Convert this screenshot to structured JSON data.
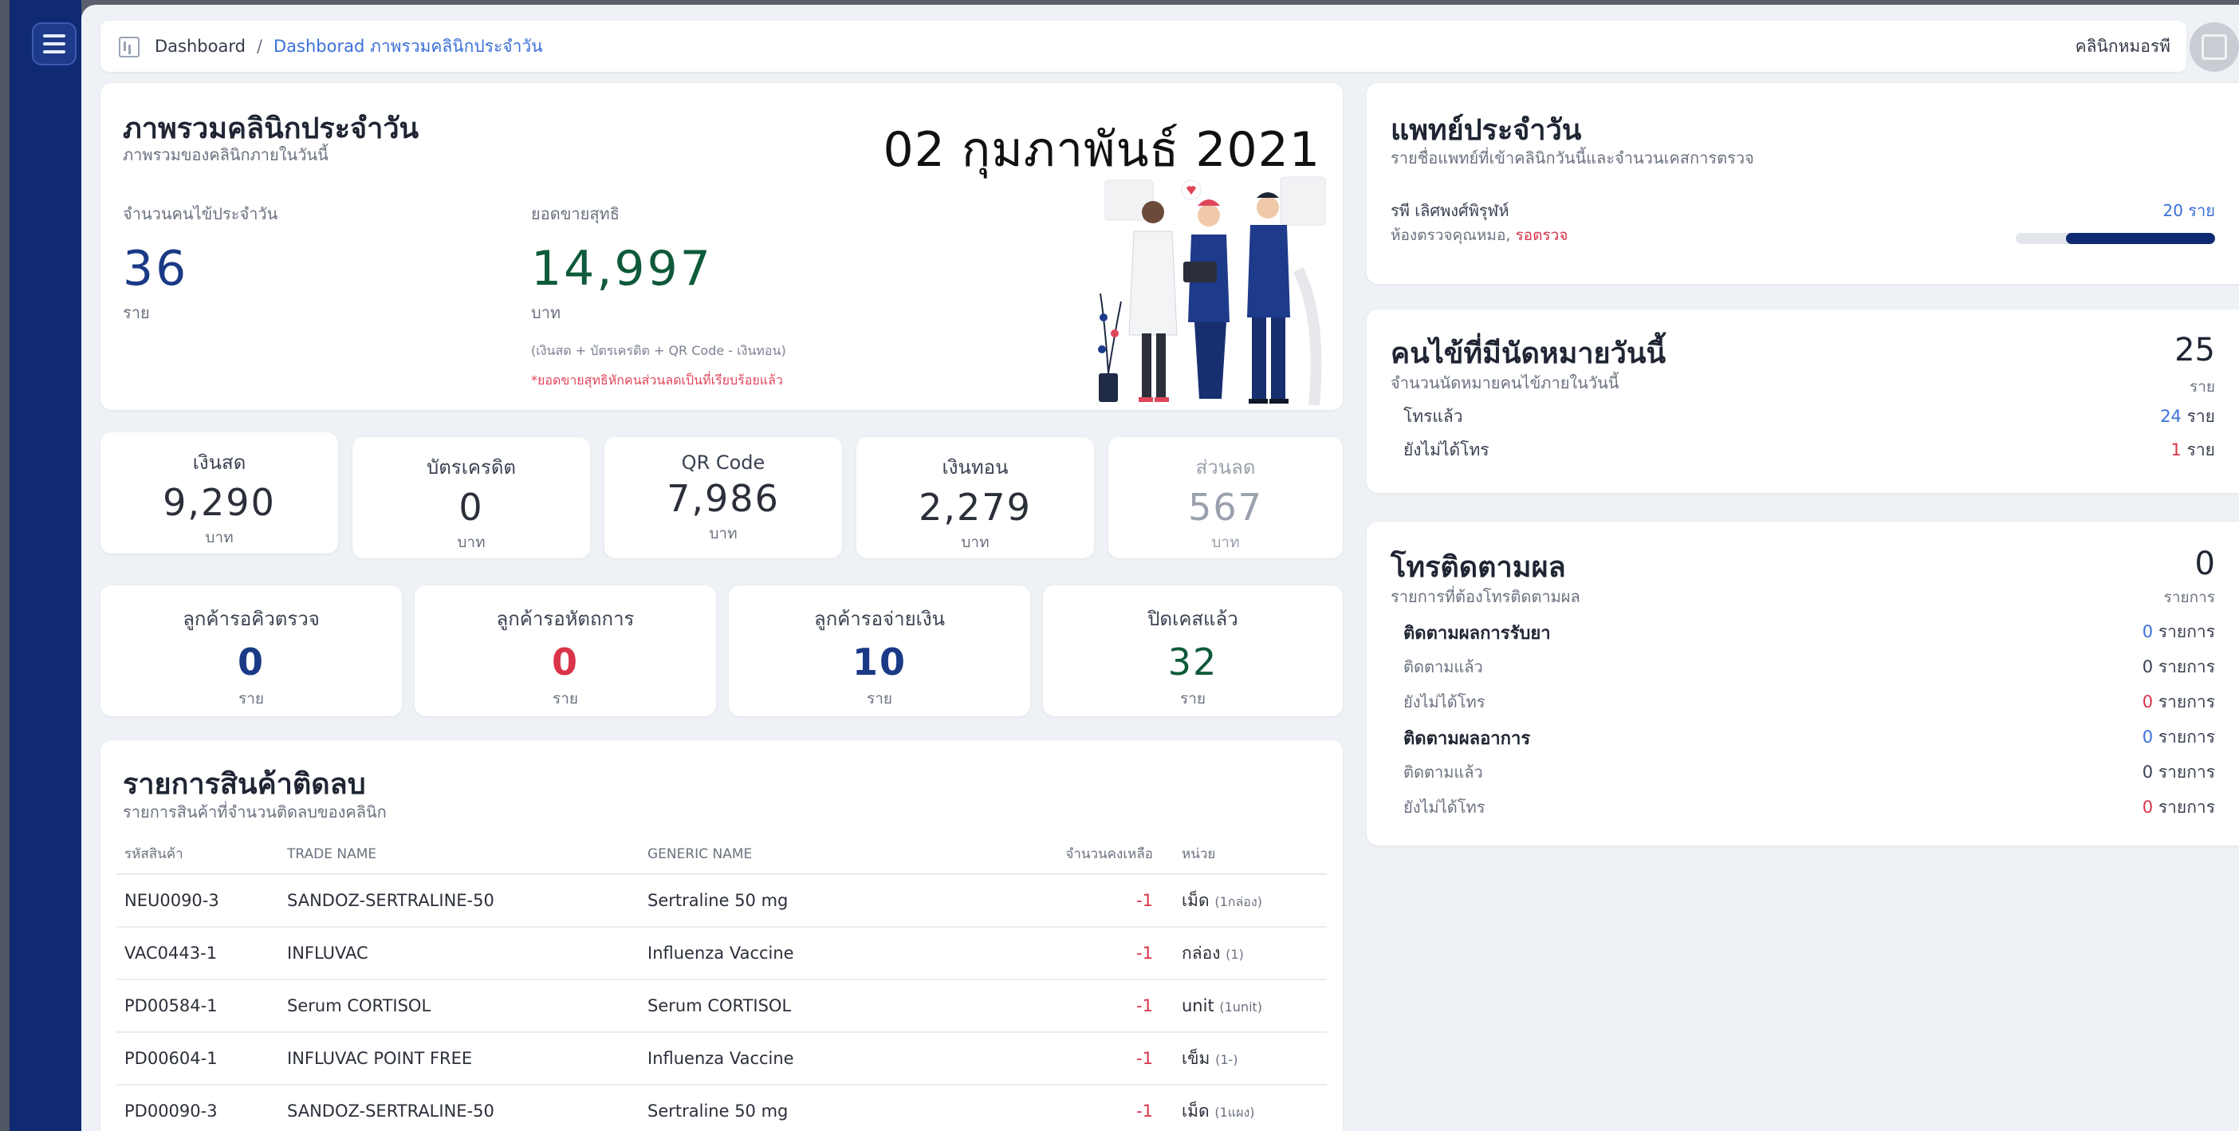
{
  "topbar": {
    "home": "Dashboard",
    "separator": "/",
    "current": "Dashborad ภาพรวมคลินิกประจำวัน",
    "clinic_name": "คลินิกหมอรพี"
  },
  "overview": {
    "title": "ภาพรวมคลินิกประจำวัน",
    "subtitle": "ภาพรวมของคลินิกภายในวันนี้",
    "date": "02 กุมภาพันธ์ 2021",
    "patients_label": "จำนวนคนไข้ประจำวัน",
    "patients_value": "36",
    "patients_unit": "ราย",
    "sales_label": "ยอดขายสุทธิ",
    "sales_value": "14,997",
    "sales_unit": "บาท",
    "sales_note": "(เงินสด + บัตรเครดิต + QR Code - เงินทอน)",
    "sales_warning": "*ยอดขายสุทธิหักคนส่วนลดเป็นที่เรียบร้อยแล้ว"
  },
  "payments": [
    {
      "label": "เงินสด",
      "value": "9,290",
      "unit": "บาท"
    },
    {
      "label": "บัตรเครดิต",
      "value": "0",
      "unit": "บาท"
    },
    {
      "label": "QR Code",
      "value": "7,986",
      "unit": "บาท"
    },
    {
      "label": "เงินทอน",
      "value": "2,279",
      "unit": "บาท"
    },
    {
      "label": "ส่วนลด",
      "value": "567",
      "unit": "บาท"
    }
  ],
  "status_cards": [
    {
      "label": "ลูกค้ารอคิวตรวจ",
      "value": "0",
      "unit": "ราย"
    },
    {
      "label": "ลูกค้ารอหัตถการ",
      "value": "0",
      "unit": "ราย"
    },
    {
      "label": "ลูกค้ารอจ่ายเงิน",
      "value": "10",
      "unit": "ราย"
    },
    {
      "label": "ปิดเคสแล้ว",
      "value": "32",
      "unit": "ราย"
    }
  ],
  "stock": {
    "title": "รายการสินค้าติดลบ",
    "subtitle": "รายการสินค้าที่จำนวนติดลบของคลินิก",
    "headers": [
      "รหัสสินค้า",
      "TRADE NAME",
      "GENERIC NAME",
      "จำนวนคงเหลือ",
      "หน่วย"
    ],
    "rows": [
      {
        "code": "NEU0090-3",
        "trade": "SANDOZ-SERTRALINE-50",
        "generic": "Sertraline 50 mg",
        "remain": "-1",
        "unit": "เม็ด",
        "unit_note": "(1กล่อง)"
      },
      {
        "code": "VAC0443-1",
        "trade": "INFLUVAC",
        "generic": "Influenza Vaccine",
        "remain": "-1",
        "unit": "กล่อง",
        "unit_note": "(1)"
      },
      {
        "code": "PD00584-1",
        "trade": "Serum CORTISOL",
        "generic": "Serum CORTISOL",
        "remain": "-1",
        "unit": "unit",
        "unit_note": "(1unit)"
      },
      {
        "code": "PD00604-1",
        "trade": "INFLUVAC POINT FREE",
        "generic": "Influenza Vaccine",
        "remain": "-1",
        "unit": "เข็ม",
        "unit_note": "(1-)"
      },
      {
        "code": "PD00090-3",
        "trade": "SANDOZ-SERTRALINE-50",
        "generic": "Sertraline 50 mg",
        "remain": "-1",
        "unit": "เม็ด",
        "unit_note": "(1แผง)"
      }
    ]
  },
  "doctor": {
    "title": "แพทย์ประจำวัน",
    "subtitle": "รายชื่อแพทย์ที่เข้าคลินิกวันนี้และจำนวนเคสการตรวจ",
    "name": "รพี เลิศพงศ์พิรุฬห์",
    "room": "ห้องตรวจคุณหมอ,",
    "room_status": "รอตรวจ",
    "count": "20 ราย",
    "progress": 0.75
  },
  "appointments": {
    "title": "คนไข้ที่มีนัดหมายวันนี้",
    "subtitle": "จำนวนนัดหมายคนไข้ภายในวันนี้",
    "total": "25",
    "total_unit": "ราย",
    "called_label": "โทรแล้ว",
    "called_value": "24",
    "called_unit": "ราย",
    "not_called_label": "ยังไม่ได้โทร",
    "not_called_value": "1",
    "not_called_unit": "ราย"
  },
  "followup": {
    "title": "โทรติดตามผล",
    "subtitle": "รายการที่ต้องโทรติดตามผล",
    "total": "0",
    "total_unit": "รายการ",
    "medicine_head": "ติดตามผลการรับยา",
    "medicine_total": "0",
    "medicine_done_label": "ติดตามแล้ว",
    "medicine_done": "0",
    "medicine_pending_label": "ยังไม่ได้โทร",
    "medicine_pending": "0",
    "symptom_head": "ติดตามผลอาการ",
    "symptom_total": "0",
    "symptom_done_label": "ติดตามแล้ว",
    "symptom_done": "0",
    "symptom_pending_label": "ยังไม่ได้โทร",
    "symptom_pending": "0",
    "unit": "รายการ"
  }
}
